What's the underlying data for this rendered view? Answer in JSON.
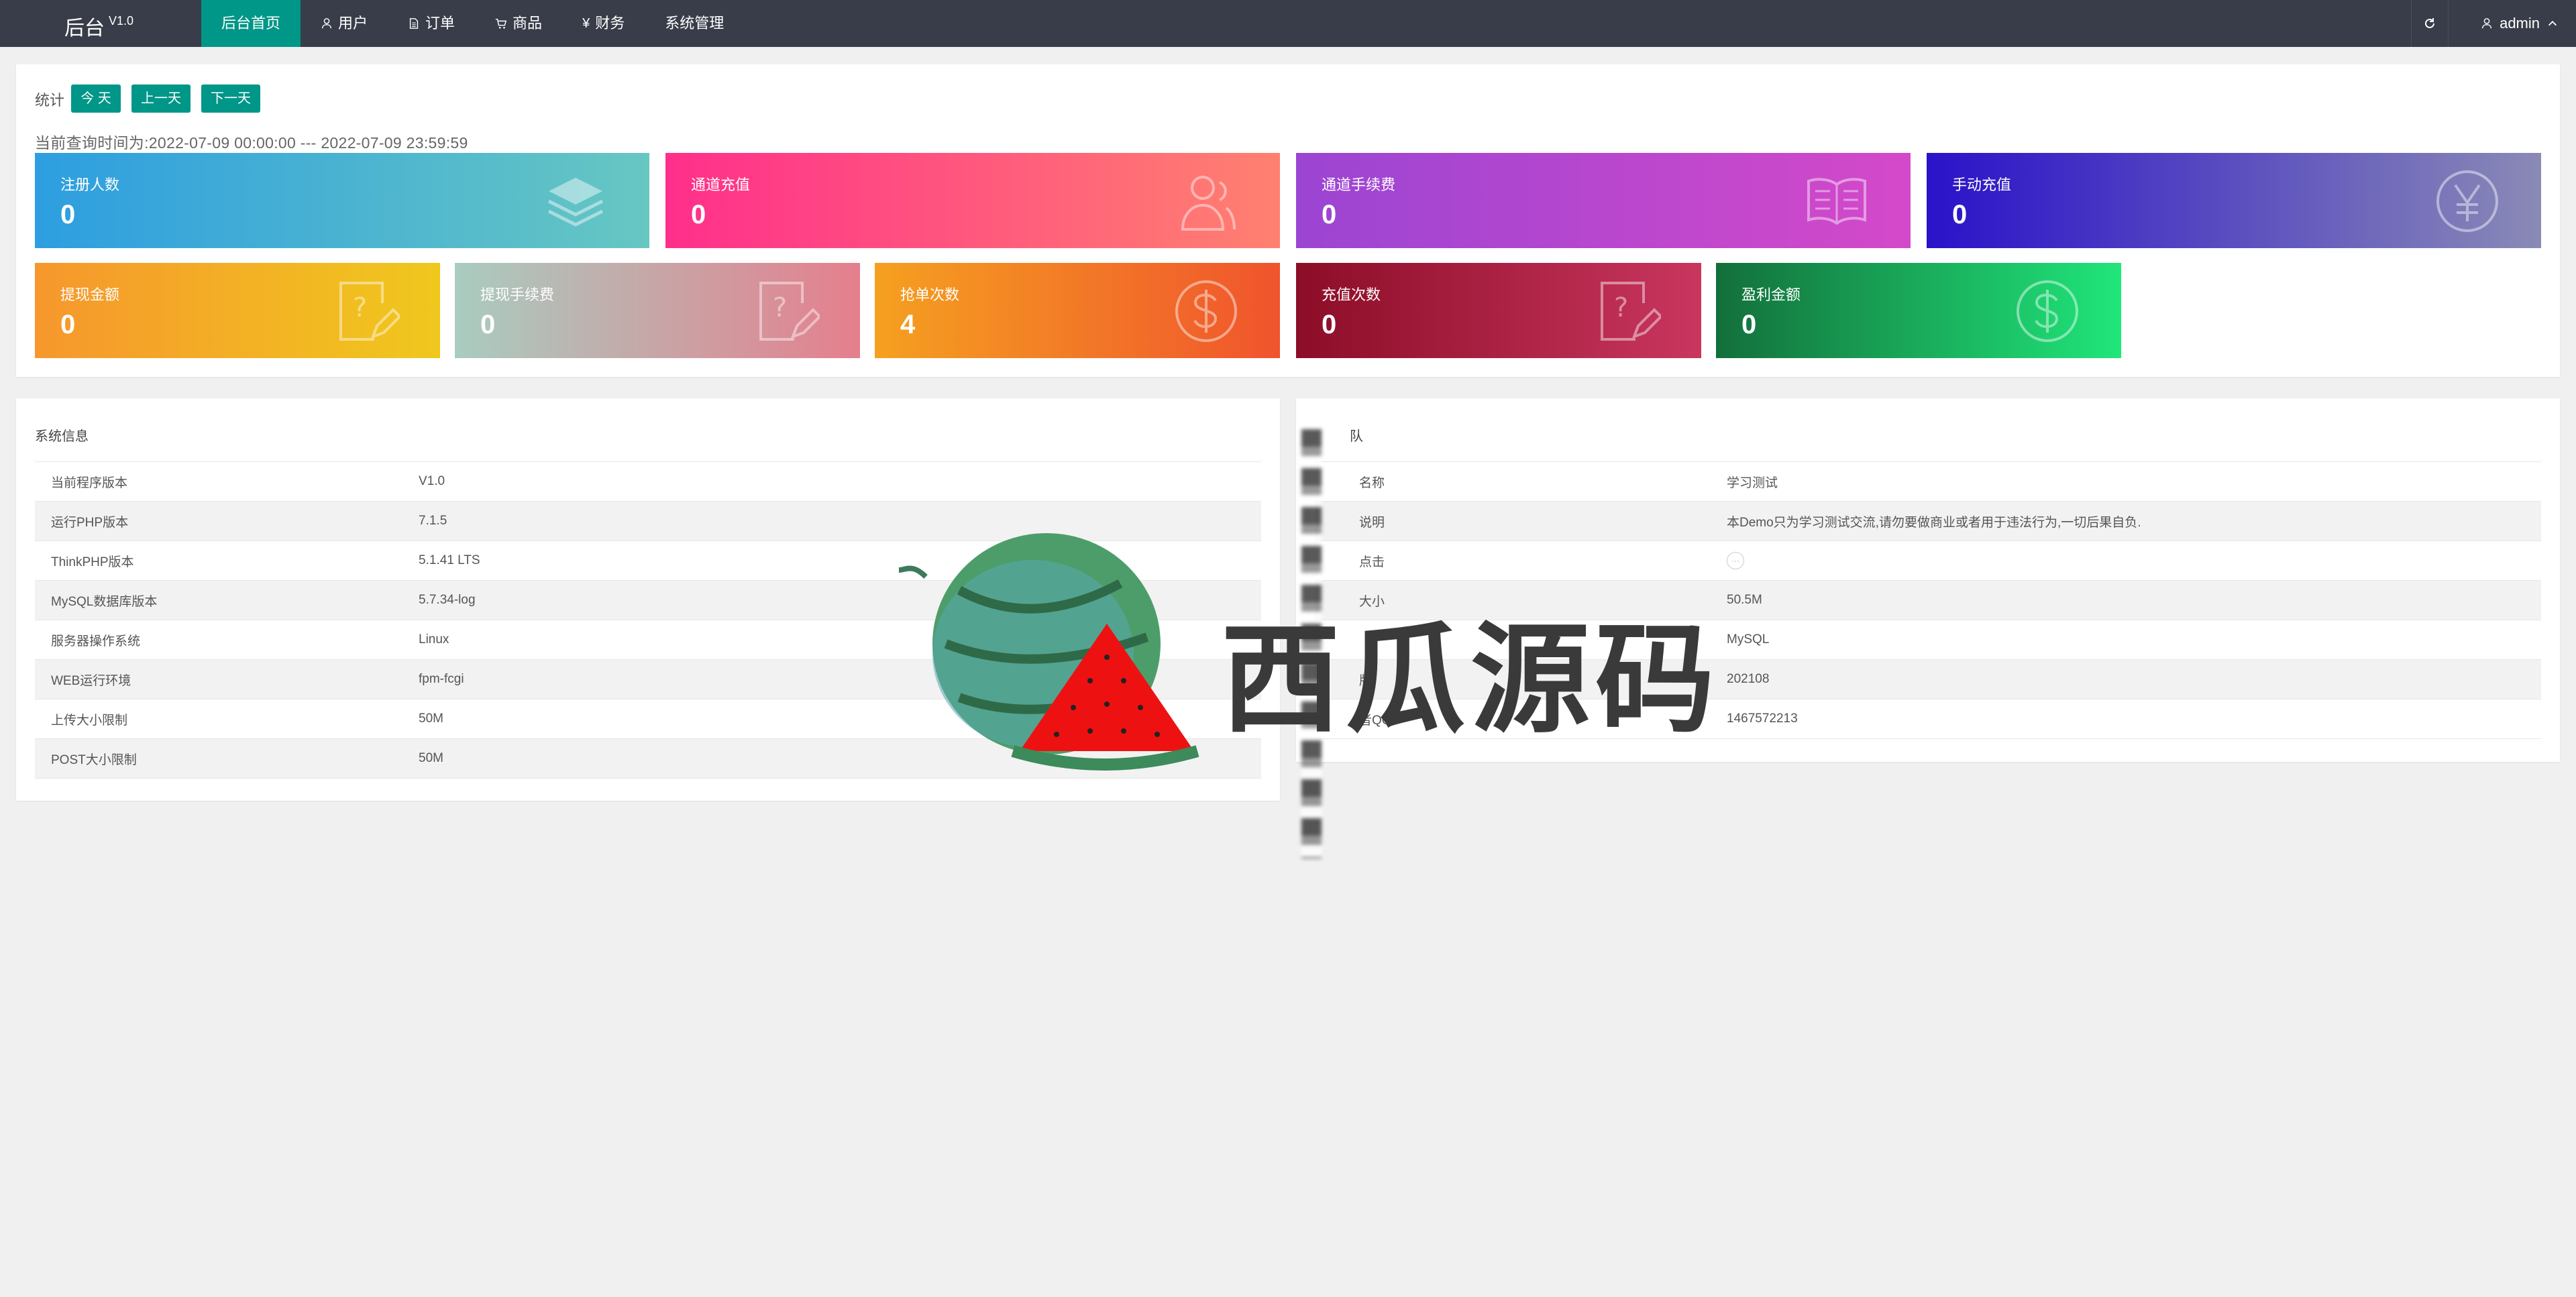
{
  "app": {
    "title": "后台",
    "version": "V1.0"
  },
  "nav": {
    "items": [
      {
        "label": "后台首页",
        "icon": "",
        "active": true
      },
      {
        "label": "用户",
        "icon": "user-icon",
        "active": false
      },
      {
        "label": "订单",
        "icon": "document-icon",
        "active": false
      },
      {
        "label": "商品",
        "icon": "cart-icon",
        "active": false
      },
      {
        "label": "财务",
        "icon": "yen-icon",
        "active": false
      },
      {
        "label": "系统管理",
        "icon": "",
        "active": false
      }
    ],
    "user_name": "admin"
  },
  "stats": {
    "label": "统计",
    "buttons": {
      "today": "今 天",
      "prev": "上一天",
      "next": "下一天"
    },
    "range_text": "当前查询时间为:2022-07-09 00:00:00 --- 2022-07-09 23:59:59",
    "tiles": [
      {
        "title": "注册人数",
        "value": "0",
        "icon": "stack-layers-icon"
      },
      {
        "title": "通道充值",
        "value": "0",
        "icon": "users-icon"
      },
      {
        "title": "通道手续费",
        "value": "0",
        "icon": "open-book-icon"
      },
      {
        "title": "手动充值",
        "value": "0",
        "icon": "yen-circle-icon"
      },
      {
        "title": "提现金额",
        "value": "0",
        "icon": "question-edit-icon"
      },
      {
        "title": "提现手续费",
        "value": "0",
        "icon": "question-edit-icon"
      },
      {
        "title": "抢单次数",
        "value": "4",
        "icon": "dollar-circle-icon"
      },
      {
        "title": "充值次数",
        "value": "0",
        "icon": "question-edit-icon"
      },
      {
        "title": "盈利金额",
        "value": "0",
        "icon": "dollar-circle-icon"
      }
    ]
  },
  "system_info": {
    "title": "系统信息",
    "rows": [
      {
        "k": "当前程序版本",
        "v": "V1.0"
      },
      {
        "k": "运行PHP版本",
        "v": "7.1.5"
      },
      {
        "k": "ThinkPHP版本",
        "v": "5.1.41 LTS"
      },
      {
        "k": "MySQL数据库版本",
        "v": "5.7.34-log"
      },
      {
        "k": "服务器操作系统",
        "v": "Linux"
      },
      {
        "k": "WEB运行环境",
        "v": "fpm-fcgi"
      },
      {
        "k": "上传大小限制",
        "v": "50M"
      },
      {
        "k": "POST大小限制",
        "v": "50M"
      }
    ]
  },
  "team": {
    "title": "队",
    "rows": [
      {
        "k": "名称",
        "v": "学习测试"
      },
      {
        "k": "说明",
        "v": "本Demo只为学习测试交流,请勿要做商业或者用于违法行为,一切后果自负."
      },
      {
        "k": "点击",
        "v": ""
      },
      {
        "k": "大小",
        "v": "50.5M"
      },
      {
        "k": "",
        "v": "MySQL"
      },
      {
        "k": "版",
        "v": "202108"
      },
      {
        "k": "者QQ",
        "v": "1467572213"
      }
    ]
  },
  "watermark": {
    "text": "西瓜源码"
  },
  "colors": {
    "accent": "#009688",
    "nav_bg": "#393d49"
  }
}
